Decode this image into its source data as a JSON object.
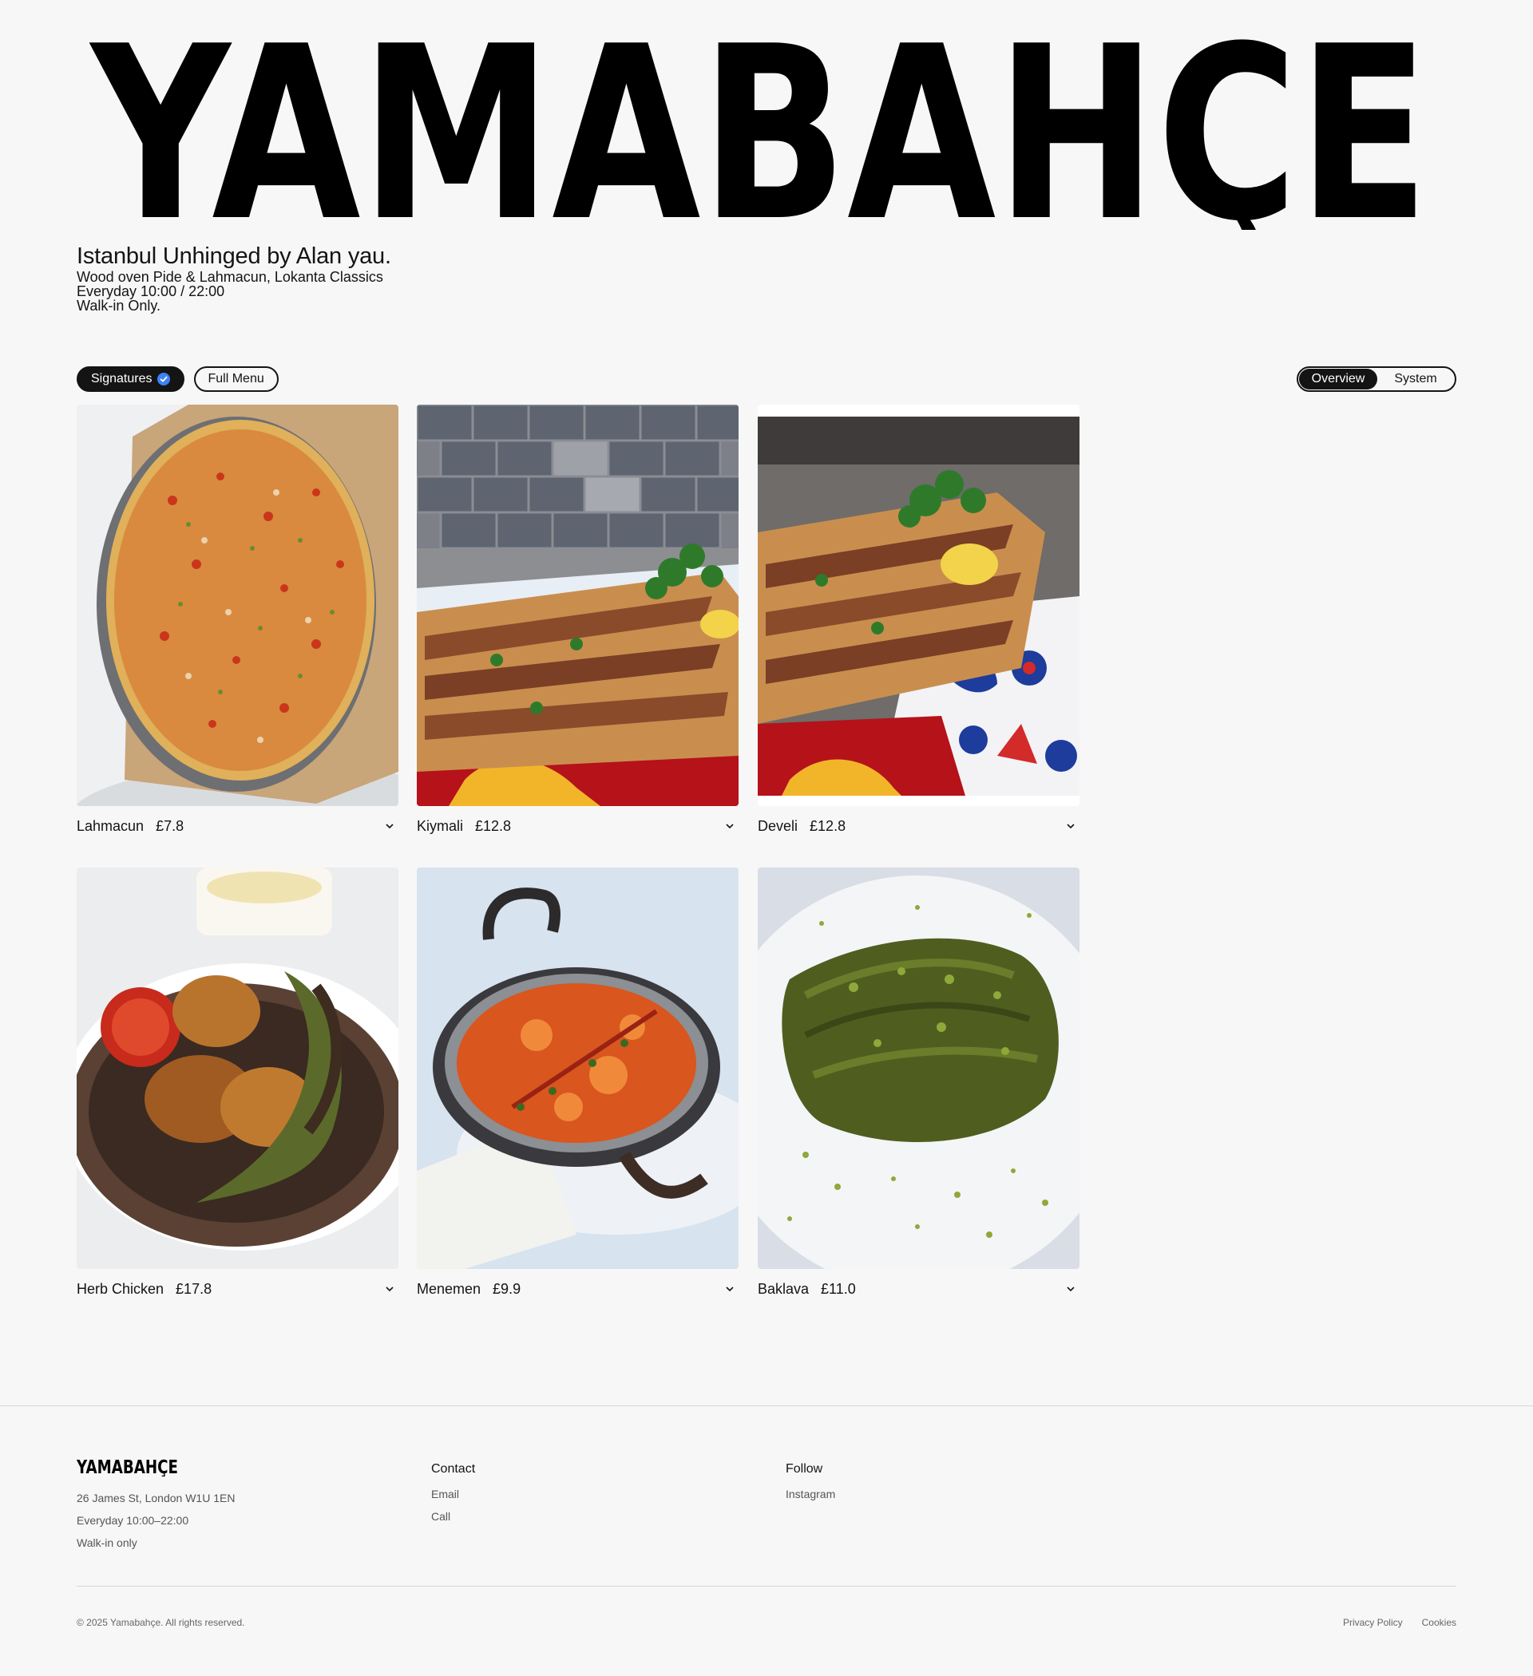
{
  "brand": {
    "name": "YAMABAHÇE"
  },
  "intro": {
    "title": "Istanbul Unhinged by Alan yau.",
    "line1": "Wood oven Pide & Lahmacun, Lokanta Classics",
    "line2": "Everyday 10:00 / 22:00",
    "line3": "Walk-in Only."
  },
  "filters": {
    "signatures": "Signatures",
    "full_menu": "Full Menu"
  },
  "view_toggle": {
    "overview": "Overview",
    "system": "System"
  },
  "dishes": [
    {
      "name": "Lahmacun",
      "price": "£7.8"
    },
    {
      "name": "Kiymali",
      "price": "£12.8"
    },
    {
      "name": "Develi",
      "price": "£12.8"
    },
    {
      "name": "Herb Chicken",
      "price": "£17.8"
    },
    {
      "name": "Menemen",
      "price": "£9.9"
    },
    {
      "name": "Baklava",
      "price": "£11.0"
    }
  ],
  "footer": {
    "address": "26 James St, London W1U 1EN",
    "hours": "Everyday 10:00–22:00",
    "walkin": "Walk-in only",
    "contact_heading": "Contact",
    "email": "Email",
    "call": "Call",
    "follow_heading": "Follow",
    "instagram": "Instagram",
    "copyright": "© 2025 Yamabahçe. All rights reserved.",
    "privacy": "Privacy Policy",
    "cookies": "Cookies"
  },
  "colors": {
    "ink": "#141414",
    "background": "#f7f7f7",
    "verified": "#3b82f6"
  }
}
